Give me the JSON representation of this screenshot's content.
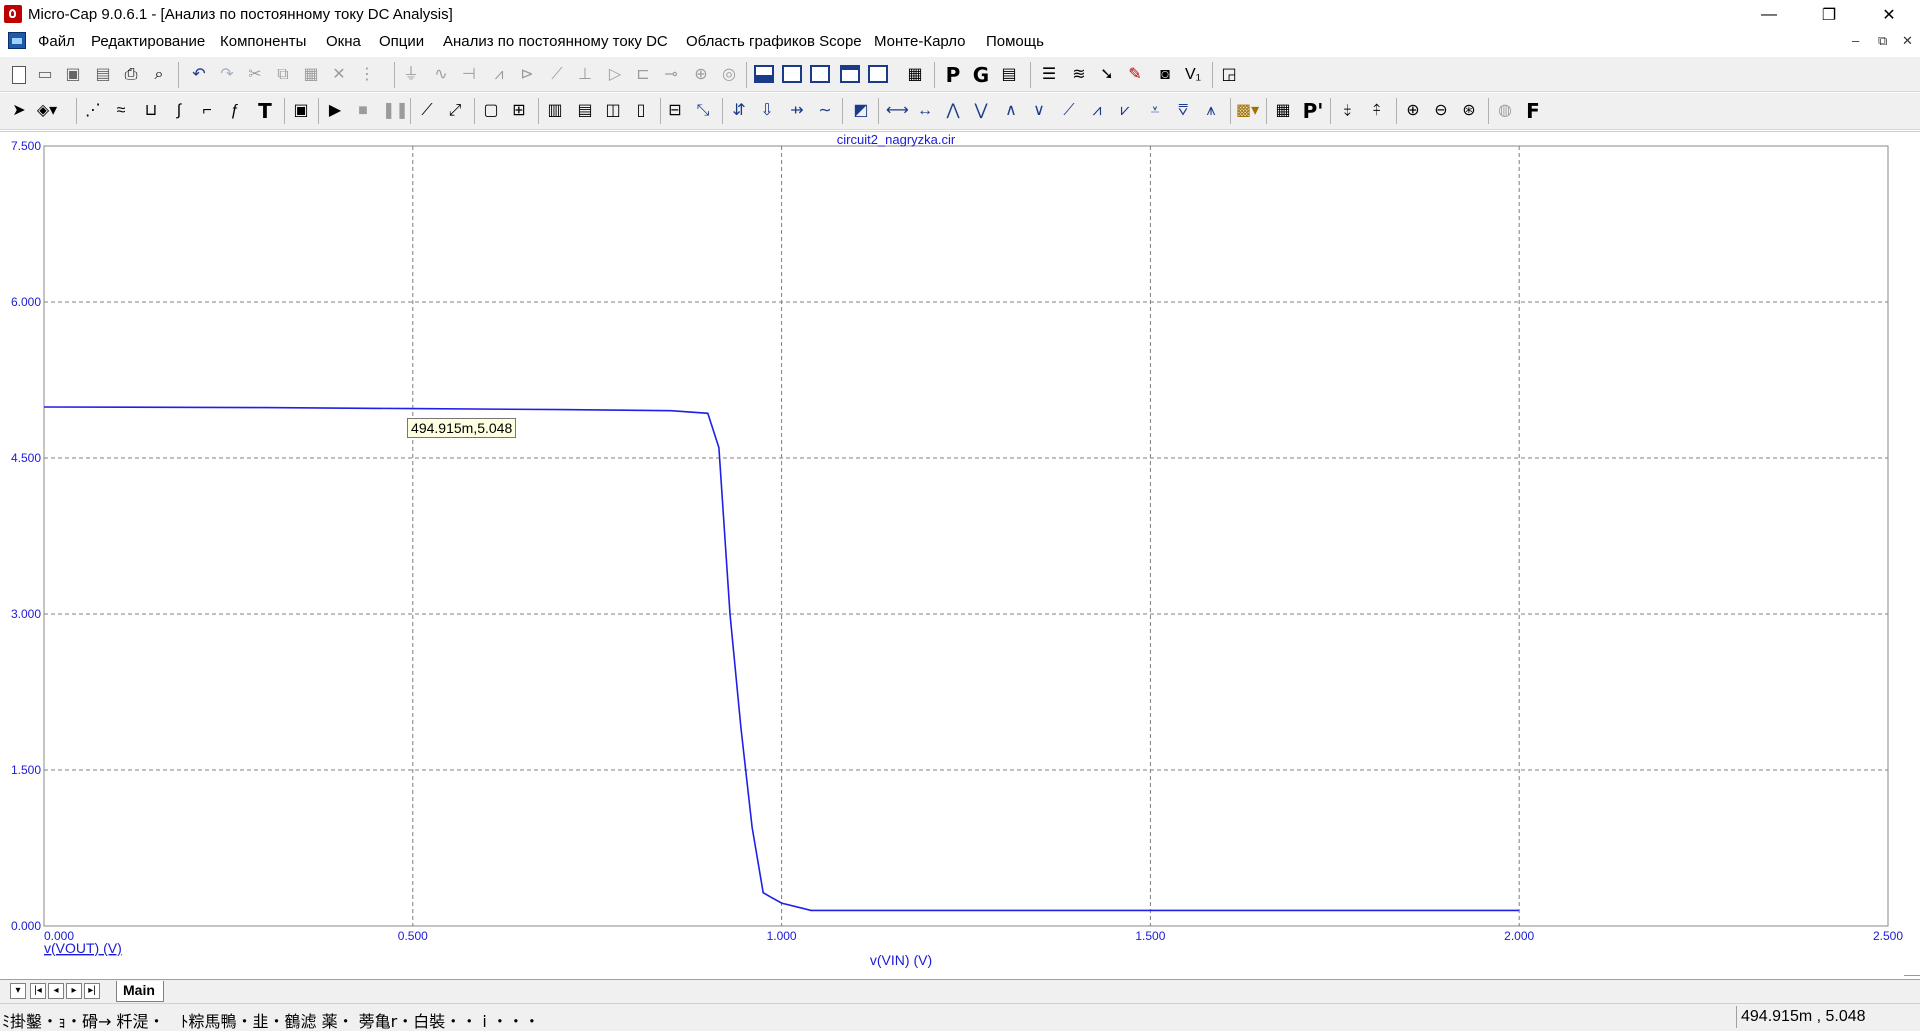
{
  "window": {
    "title": "Micro-Cap 9.0.6.1 - [Анализ по постоянному току DC Analysis]",
    "controls": {
      "minimize": "—",
      "restore": "❐",
      "close": "✕"
    },
    "mdi_controls": {
      "minimize": "–",
      "restore": "⧉",
      "close": "✕"
    }
  },
  "menu": [
    "Файл",
    "Редактирование",
    "Компоненты",
    "Окна",
    "Опции",
    "Анализ по постоянному току DC",
    "Область графиков Scope",
    "Монте-Карло",
    "Помощь"
  ],
  "toolbar_letters": {
    "p": "P",
    "g": "G",
    "pp": "P'",
    "f": "F",
    "t": "T"
  },
  "plot": {
    "file_title": "circuit2_nagryzka.cir",
    "tooltip": "494.915m,5.048",
    "y_axis_name": "v(VOUT) (V)",
    "x_axis_name": "v(VIN) (V)",
    "line_color": "#1f1fe8",
    "grid_color": "#808080"
  },
  "chart_data": {
    "type": "line",
    "title": "circuit2_nagryzka.cir",
    "xlabel": "v(VIN) (V)",
    "ylabel": "v(VOUT) (V)",
    "xlim": [
      0,
      2.5
    ],
    "ylim": [
      0,
      7.5
    ],
    "x_ticks": [
      "0.000",
      "0.500",
      "1.000",
      "1.500",
      "2.000",
      "2.500"
    ],
    "y_ticks": [
      "0.000",
      "1.500",
      "3.000",
      "4.500",
      "6.000",
      "7.500"
    ],
    "grid": true,
    "series": [
      {
        "name": "v(VOUT) (V)",
        "x": [
          0.0,
          0.3,
          0.5,
          0.7,
          0.85,
          0.9,
          0.915,
          0.93,
          0.945,
          0.96,
          0.975,
          0.985,
          1.0,
          1.04,
          1.2,
          1.5,
          2.0
        ],
        "y": [
          4.99,
          4.985,
          4.975,
          4.965,
          4.955,
          4.93,
          4.6,
          3.0,
          1.9,
          0.95,
          0.32,
          0.28,
          0.22,
          0.15,
          0.15,
          0.15,
          0.15
        ]
      }
    ]
  },
  "tabs": {
    "active": "Main"
  },
  "status": {
    "left": "ﾐ掛鑿・ｮ・磆→ 粁湜・　ﾄ粽馬鴨・韭・鶴滤 薬・ 蒡亀r・白裝・・ i ・・・",
    "right": "494.915m , 5.048"
  }
}
